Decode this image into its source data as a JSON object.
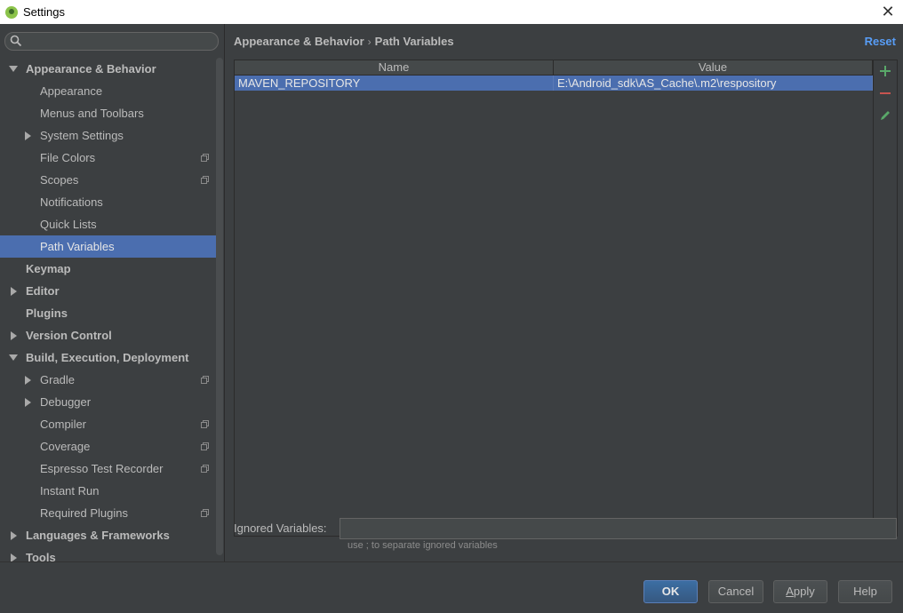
{
  "window": {
    "title": "Settings"
  },
  "search": {
    "placeholder": ""
  },
  "sidebar": {
    "items": [
      {
        "label": "Appearance & Behavior",
        "level": 0,
        "expander": "down"
      },
      {
        "label": "Appearance",
        "level": 1
      },
      {
        "label": "Menus and Toolbars",
        "level": 1
      },
      {
        "label": "System Settings",
        "level": 1,
        "expander": "right"
      },
      {
        "label": "File Colors",
        "level": 1,
        "project_icon": true
      },
      {
        "label": "Scopes",
        "level": 1,
        "project_icon": true
      },
      {
        "label": "Notifications",
        "level": 1
      },
      {
        "label": "Quick Lists",
        "level": 1
      },
      {
        "label": "Path Variables",
        "level": 1,
        "selected": true
      },
      {
        "label": "Keymap",
        "level": 0
      },
      {
        "label": "Editor",
        "level": 0,
        "expander": "right"
      },
      {
        "label": "Plugins",
        "level": 0
      },
      {
        "label": "Version Control",
        "level": 0,
        "expander": "right"
      },
      {
        "label": "Build, Execution, Deployment",
        "level": 0,
        "expander": "down"
      },
      {
        "label": "Gradle",
        "level": 1,
        "expander": "right",
        "project_icon": true
      },
      {
        "label": "Debugger",
        "level": 1,
        "expander": "right"
      },
      {
        "label": "Compiler",
        "level": 1,
        "project_icon": true
      },
      {
        "label": "Coverage",
        "level": 1,
        "project_icon": true
      },
      {
        "label": "Espresso Test Recorder",
        "level": 1,
        "project_icon": true
      },
      {
        "label": "Instant Run",
        "level": 1
      },
      {
        "label": "Required Plugins",
        "level": 1,
        "project_icon": true
      },
      {
        "label": "Languages & Frameworks",
        "level": 0,
        "expander": "right"
      },
      {
        "label": "Tools",
        "level": 0,
        "expander": "right"
      }
    ]
  },
  "main": {
    "breadcrumb": {
      "parent": "Appearance & Behavior",
      "separator": "›",
      "current": "Path Variables"
    },
    "reset_label": "Reset",
    "table": {
      "columns": [
        "Name",
        "Value"
      ],
      "rows": [
        {
          "name": "MAVEN_REPOSITORY",
          "value": "E:\\Android_sdk\\AS_Cache\\.m2\\respository",
          "selected": true
        }
      ]
    },
    "tools": [
      "add-icon",
      "remove-icon",
      "edit-icon"
    ],
    "ignored": {
      "label": "Ignored Variables:",
      "value": "",
      "hint": "use ; to separate ignored variables"
    }
  },
  "buttons": {
    "ok": "OK",
    "cancel": "Cancel",
    "apply": "Apply",
    "help": "Help"
  },
  "colors": {
    "background": "#3c3f41",
    "selection": "#4b6eaf",
    "accent_link": "#589df6",
    "add_icon": "#59a869",
    "remove_icon": "#c75450"
  }
}
